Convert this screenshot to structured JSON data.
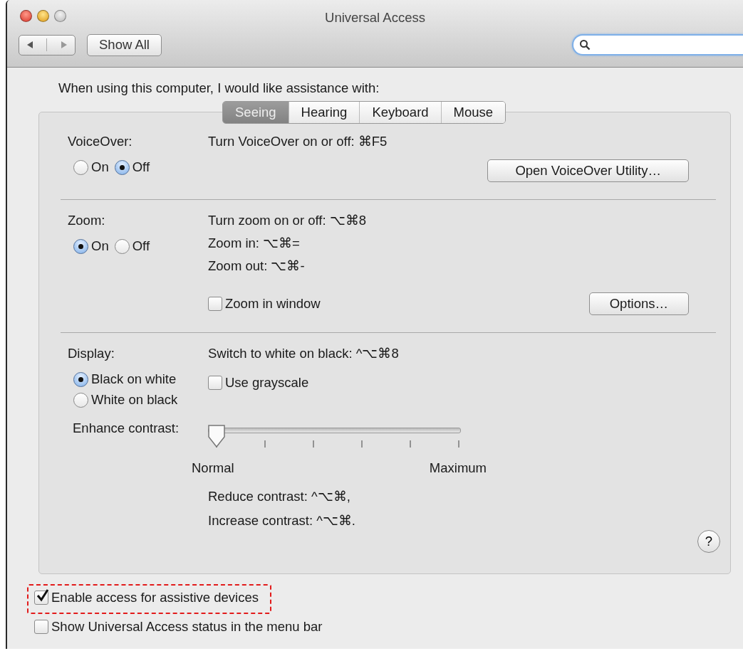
{
  "window": {
    "title": "Universal Access"
  },
  "toolbar": {
    "show_all": "Show All"
  },
  "prompt": "When using this computer, I would like assistance with:",
  "tabs": [
    {
      "label": "Seeing",
      "selected": true
    },
    {
      "label": "Hearing",
      "selected": false
    },
    {
      "label": "Keyboard",
      "selected": false
    },
    {
      "label": "Mouse",
      "selected": false
    }
  ],
  "voiceover": {
    "label": "VoiceOver:",
    "options": [
      {
        "label": "On",
        "selected": false
      },
      {
        "label": "Off",
        "selected": true
      }
    ],
    "shortcut": "Turn VoiceOver on or off: ⌘F5",
    "button": "Open VoiceOver Utility…"
  },
  "zoom": {
    "label": "Zoom:",
    "options": [
      {
        "label": "On",
        "selected": true
      },
      {
        "label": "Off",
        "selected": false
      }
    ],
    "shortcuts": [
      "Turn zoom on or off: ⌥⌘8",
      "Zoom in: ⌥⌘=",
      "Zoom out: ⌥⌘-"
    ],
    "zoom_in_window": {
      "label": "Zoom in window",
      "checked": false
    },
    "button": "Options…"
  },
  "display": {
    "label": "Display:",
    "options": [
      {
        "label": "Black on white",
        "selected": true
      },
      {
        "label": "White on black",
        "selected": false
      }
    ],
    "shortcut": "Switch to white on black: ^⌥⌘8",
    "grayscale": {
      "label": "Use grayscale",
      "checked": false
    },
    "contrast": {
      "label": "Enhance contrast:",
      "level": 0,
      "min_label": "Normal",
      "max_label": "Maximum"
    },
    "shortcuts": [
      "Reduce contrast: ^⌥⌘,",
      "Increase contrast: ^⌥⌘."
    ],
    "help": "?"
  },
  "options": [
    {
      "label": "Enable access for assistive devices",
      "checked": true,
      "highlighted": true
    },
    {
      "label": "Show Universal Access status in the menu bar",
      "checked": false,
      "highlighted": false
    }
  ]
}
